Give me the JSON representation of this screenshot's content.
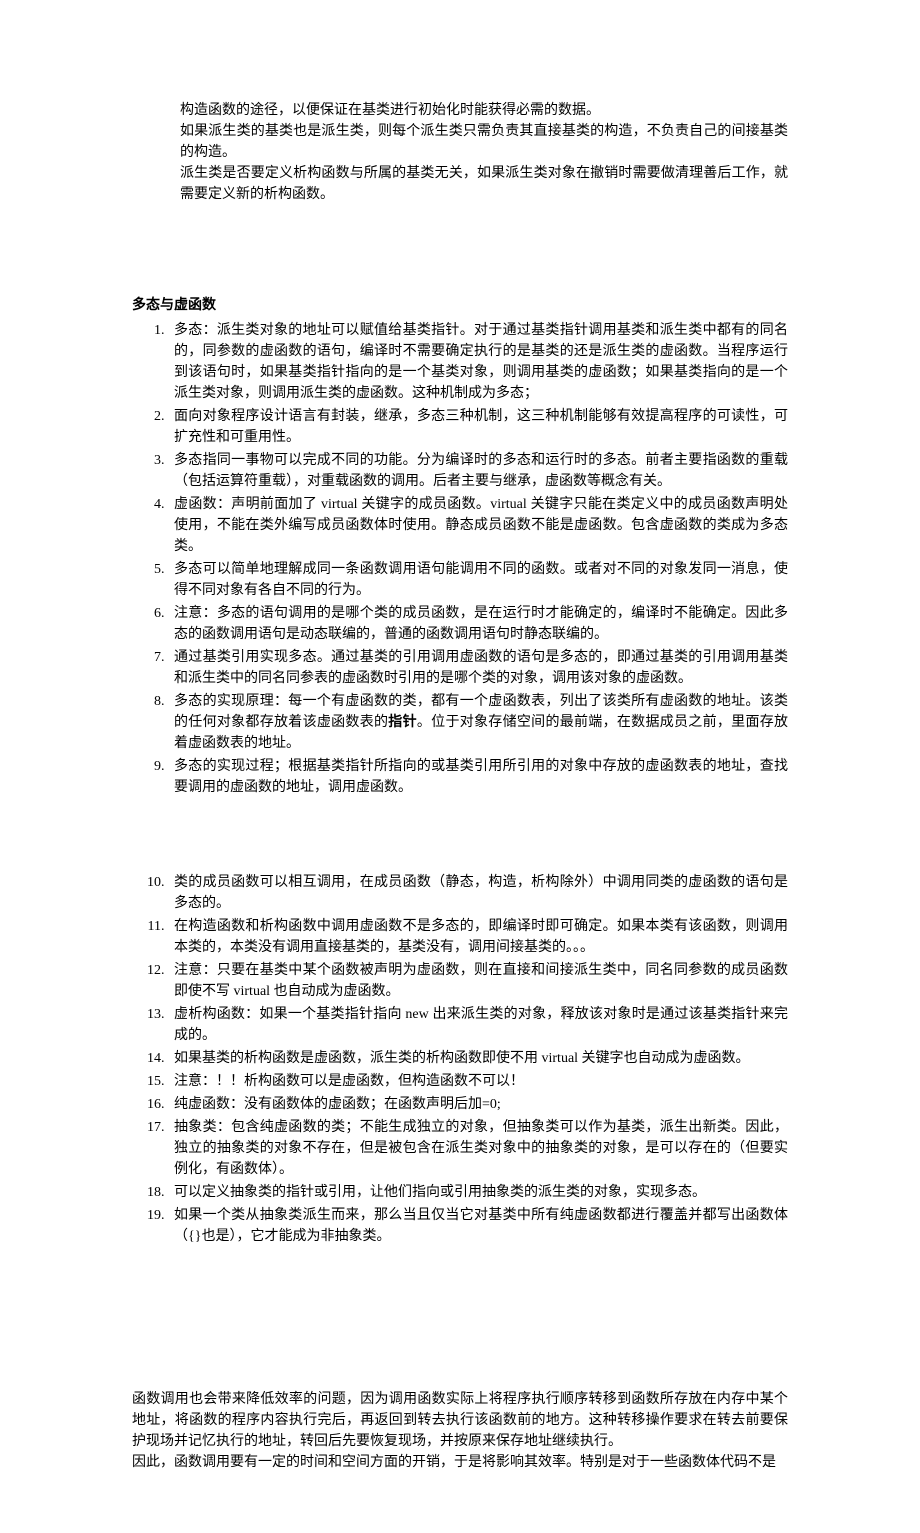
{
  "intro": {
    "p1": "构造函数的途径，以便保证在基类进行初始化时能获得必需的数据。",
    "p2": "如果派生类的基类也是派生类，则每个派生类只需负责其直接基类的构造，不负责自己的间接基类的构造。",
    "p3": "派生类是否要定义析构函数与所属的基类无关，如果派生类对象在撤销时需要做清理善后工作，就需要定义新的析构函数。"
  },
  "sectionTitle": "多态与虚函数",
  "listA": [
    "多态：派生类对象的地址可以赋值给基类指针。对于通过基类指针调用基类和派生类中都有的同名的，同参数的虚函数的语句，编译时不需要确定执行的是基类的还是派生类的虚函数。当程序运行到该语句时，如果基类指针指向的是一个基类对象，则调用基类的虚函数；如果基类指向的是一个派生类对象，则调用派生类的虚函数。这种机制成为多态；",
    "面向对象程序设计语言有封装，继承，多态三种机制，这三种机制能够有效提高程序的可读性，可扩充性和可重用性。",
    "多态指同一事物可以完成不同的功能。分为编译时的多态和运行时的多态。前者主要指函数的重载（包括运算符重载），对重载函数的调用。后者主要与继承，虚函数等概念有关。",
    "虚函数：声明前面加了 virtual 关键字的成员函数。virtual 关键字只能在类定义中的成员函数声明处使用，不能在类外编写成员函数体时使用。静态成员函数不能是虚函数。包含虚函数的类成为多态类。",
    "多态可以简单地理解成同一条函数调用语句能调用不同的函数。或者对不同的对象发同一消息，使得不同对象有各自不同的行为。",
    "注意：多态的语句调用的是哪个类的成员函数，是在运行时才能确定的，编译时不能确定。因此多态的函数调用语句是动态联编的，普通的函数调用语句时静态联编的。",
    "通过基类引用实现多态。通过基类的引用调用虚函数的语句是多态的，即通过基类的引用调用基类和派生类中的同名同参表的虚函数时引用的是哪个类的对象，调用该对象的虚函数。"
  ],
  "item8": {
    "prefix": "多态的实现原理：每一个有虚函数的类，都有一个虚函数表，列出了该类所有虚函数的地址。该类的任何对象都存放着该虚函数表的",
    "bold": "指针",
    "suffix": "。位于对象存储空间的最前端，在数据成员之前，里面存放着虚函数表的地址。"
  },
  "listA9": "多态的实现过程；根据基类指针所指向的或基类引用所引用的对象中存放的虚函数表的地址，查找要调用的虚函数的地址，调用虚函数。",
  "listB": [
    "类的成员函数可以相互调用，在成员函数（静态，构造，析构除外）中调用同类的虚函数的语句是多态的。",
    "在构造函数和析构函数中调用虚函数不是多态的，即编译时即可确定。如果本类有该函数，则调用本类的，本类没有调用直接基类的，基类没有，调用间接基类的。。。",
    "注意：只要在基类中某个函数被声明为虚函数，则在直接和间接派生类中，同名同参数的成员函数即使不写 virtual 也自动成为虚函数。",
    "虚析构函数：如果一个基类指针指向 new 出来派生类的对象，释放该对象时是通过该基类指针来完成的。",
    "如果基类的析构函数是虚函数，派生类的析构函数即使不用 virtual 关键字也自动成为虚函数。",
    "注意：！！析构函数可以是虚函数，但构造函数不可以！",
    "纯虚函数：没有函数体的虚函数；在函数声明后加=0;",
    "抽象类：包含纯虚函数的类；不能生成独立的对象，但抽象类可以作为基类，派生出新类。因此，独立的抽象类的对象不存在，但是被包含在派生类对象中的抽象类的对象，是可以存在的（但要实例化，有函数体）。",
    "可以定义抽象类的指针或引用，让他们指向或引用抽象类的派生类的对象，实现多态。",
    "如果一个类从抽象类派生而来，那么当且仅当它对基类中所有纯虚函数都进行覆盖并都写出函数体（{}也是），它才能成为非抽象类。"
  ],
  "tail": {
    "p1": "函数调用也会带来降低效率的问题，因为调用函数实际上将程序执行顺序转移到函数所存放在内存中某个地址，将函数的程序内容执行完后，再返回到转去执行该函数前的地方。这种转移操作要求在转去前要保护现场并记忆执行的地址，转回后先要恢复现场，并按原来保存地址继续执行。",
    "p2": "因此，函数调用要有一定的时间和空间方面的开销，于是将影响其效率。特别是对于一些函数体代码不是"
  }
}
